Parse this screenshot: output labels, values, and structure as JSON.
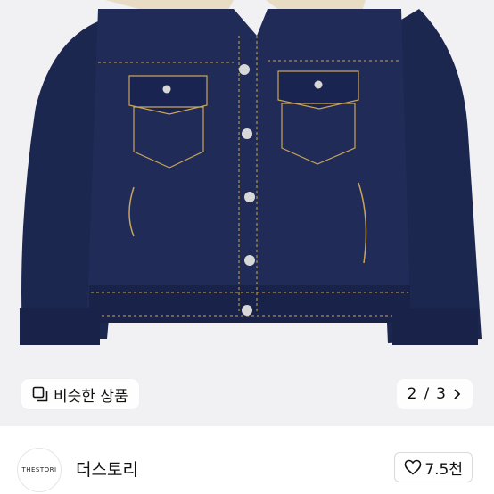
{
  "similar_products": {
    "label": "비슷한 상품",
    "icon": "similar-items-icon"
  },
  "gallery": {
    "current": "2",
    "separator": "/",
    "total": "3",
    "next_icon": "chevron-right-icon"
  },
  "seller": {
    "name": "더스토리",
    "avatar_text": "THESTORI"
  },
  "like": {
    "count": "7.5천",
    "icon": "heart-outline-icon"
  },
  "colors": {
    "denim": "#1c2750",
    "stitch": "#c9a55c",
    "sherpa": "#e8dcc4",
    "background": "#f1f1f3"
  }
}
